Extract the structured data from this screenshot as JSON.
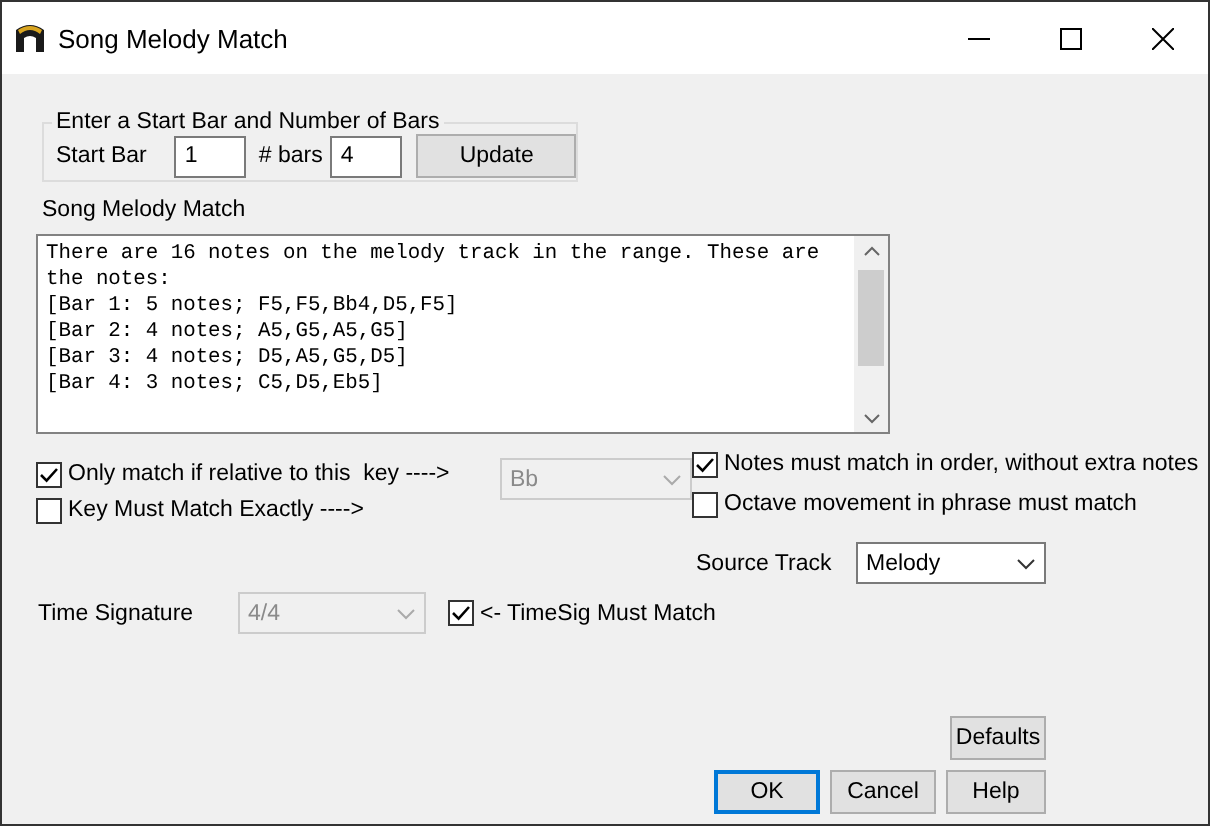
{
  "window": {
    "title": "Song Melody Match"
  },
  "range_group": {
    "legend": "Enter a Start Bar and Number of Bars",
    "start_bar_label": "Start Bar",
    "start_bar": "1",
    "bars_label": "# bars",
    "bars": "4",
    "update_button": "Update"
  },
  "results": {
    "label": "Song Melody Match",
    "lines": [
      "There are 16 notes on the melody track in the range. These are",
      "the notes:",
      "[Bar 1: 5 notes; F5,F5,Bb4,D5,F5]",
      "[Bar 2: 4 notes; A5,G5,A5,G5]",
      "[Bar 3: 4 notes; D5,A5,G5,D5]",
      "[Bar 4: 3 notes; C5,D5,Eb5]"
    ]
  },
  "options_left": [
    {
      "label": "Only match if relative to this  key ---->",
      "checked": true
    },
    {
      "label": "Key Must Match Exactly ---->",
      "checked": false
    }
  ],
  "key_combo": {
    "value": "Bb",
    "disabled": true
  },
  "options_right": [
    {
      "label": "Notes must match in order, without extra notes",
      "checked": true
    },
    {
      "label": "Octave movement in phrase must match",
      "checked": false
    }
  ],
  "source_track": {
    "label": "Source Track",
    "value": "Melody",
    "disabled": false
  },
  "time_signature": {
    "label": "Time Signature",
    "value": "4/4",
    "disabled": true
  },
  "timesig_must_match": {
    "label": "<- TimeSig Must Match",
    "checked": true
  },
  "defaults_button": "Defaults",
  "buttons": [
    {
      "label": "OK",
      "focused": true
    },
    {
      "label": "Cancel",
      "focused": false
    },
    {
      "label": "Help",
      "focused": false
    }
  ]
}
